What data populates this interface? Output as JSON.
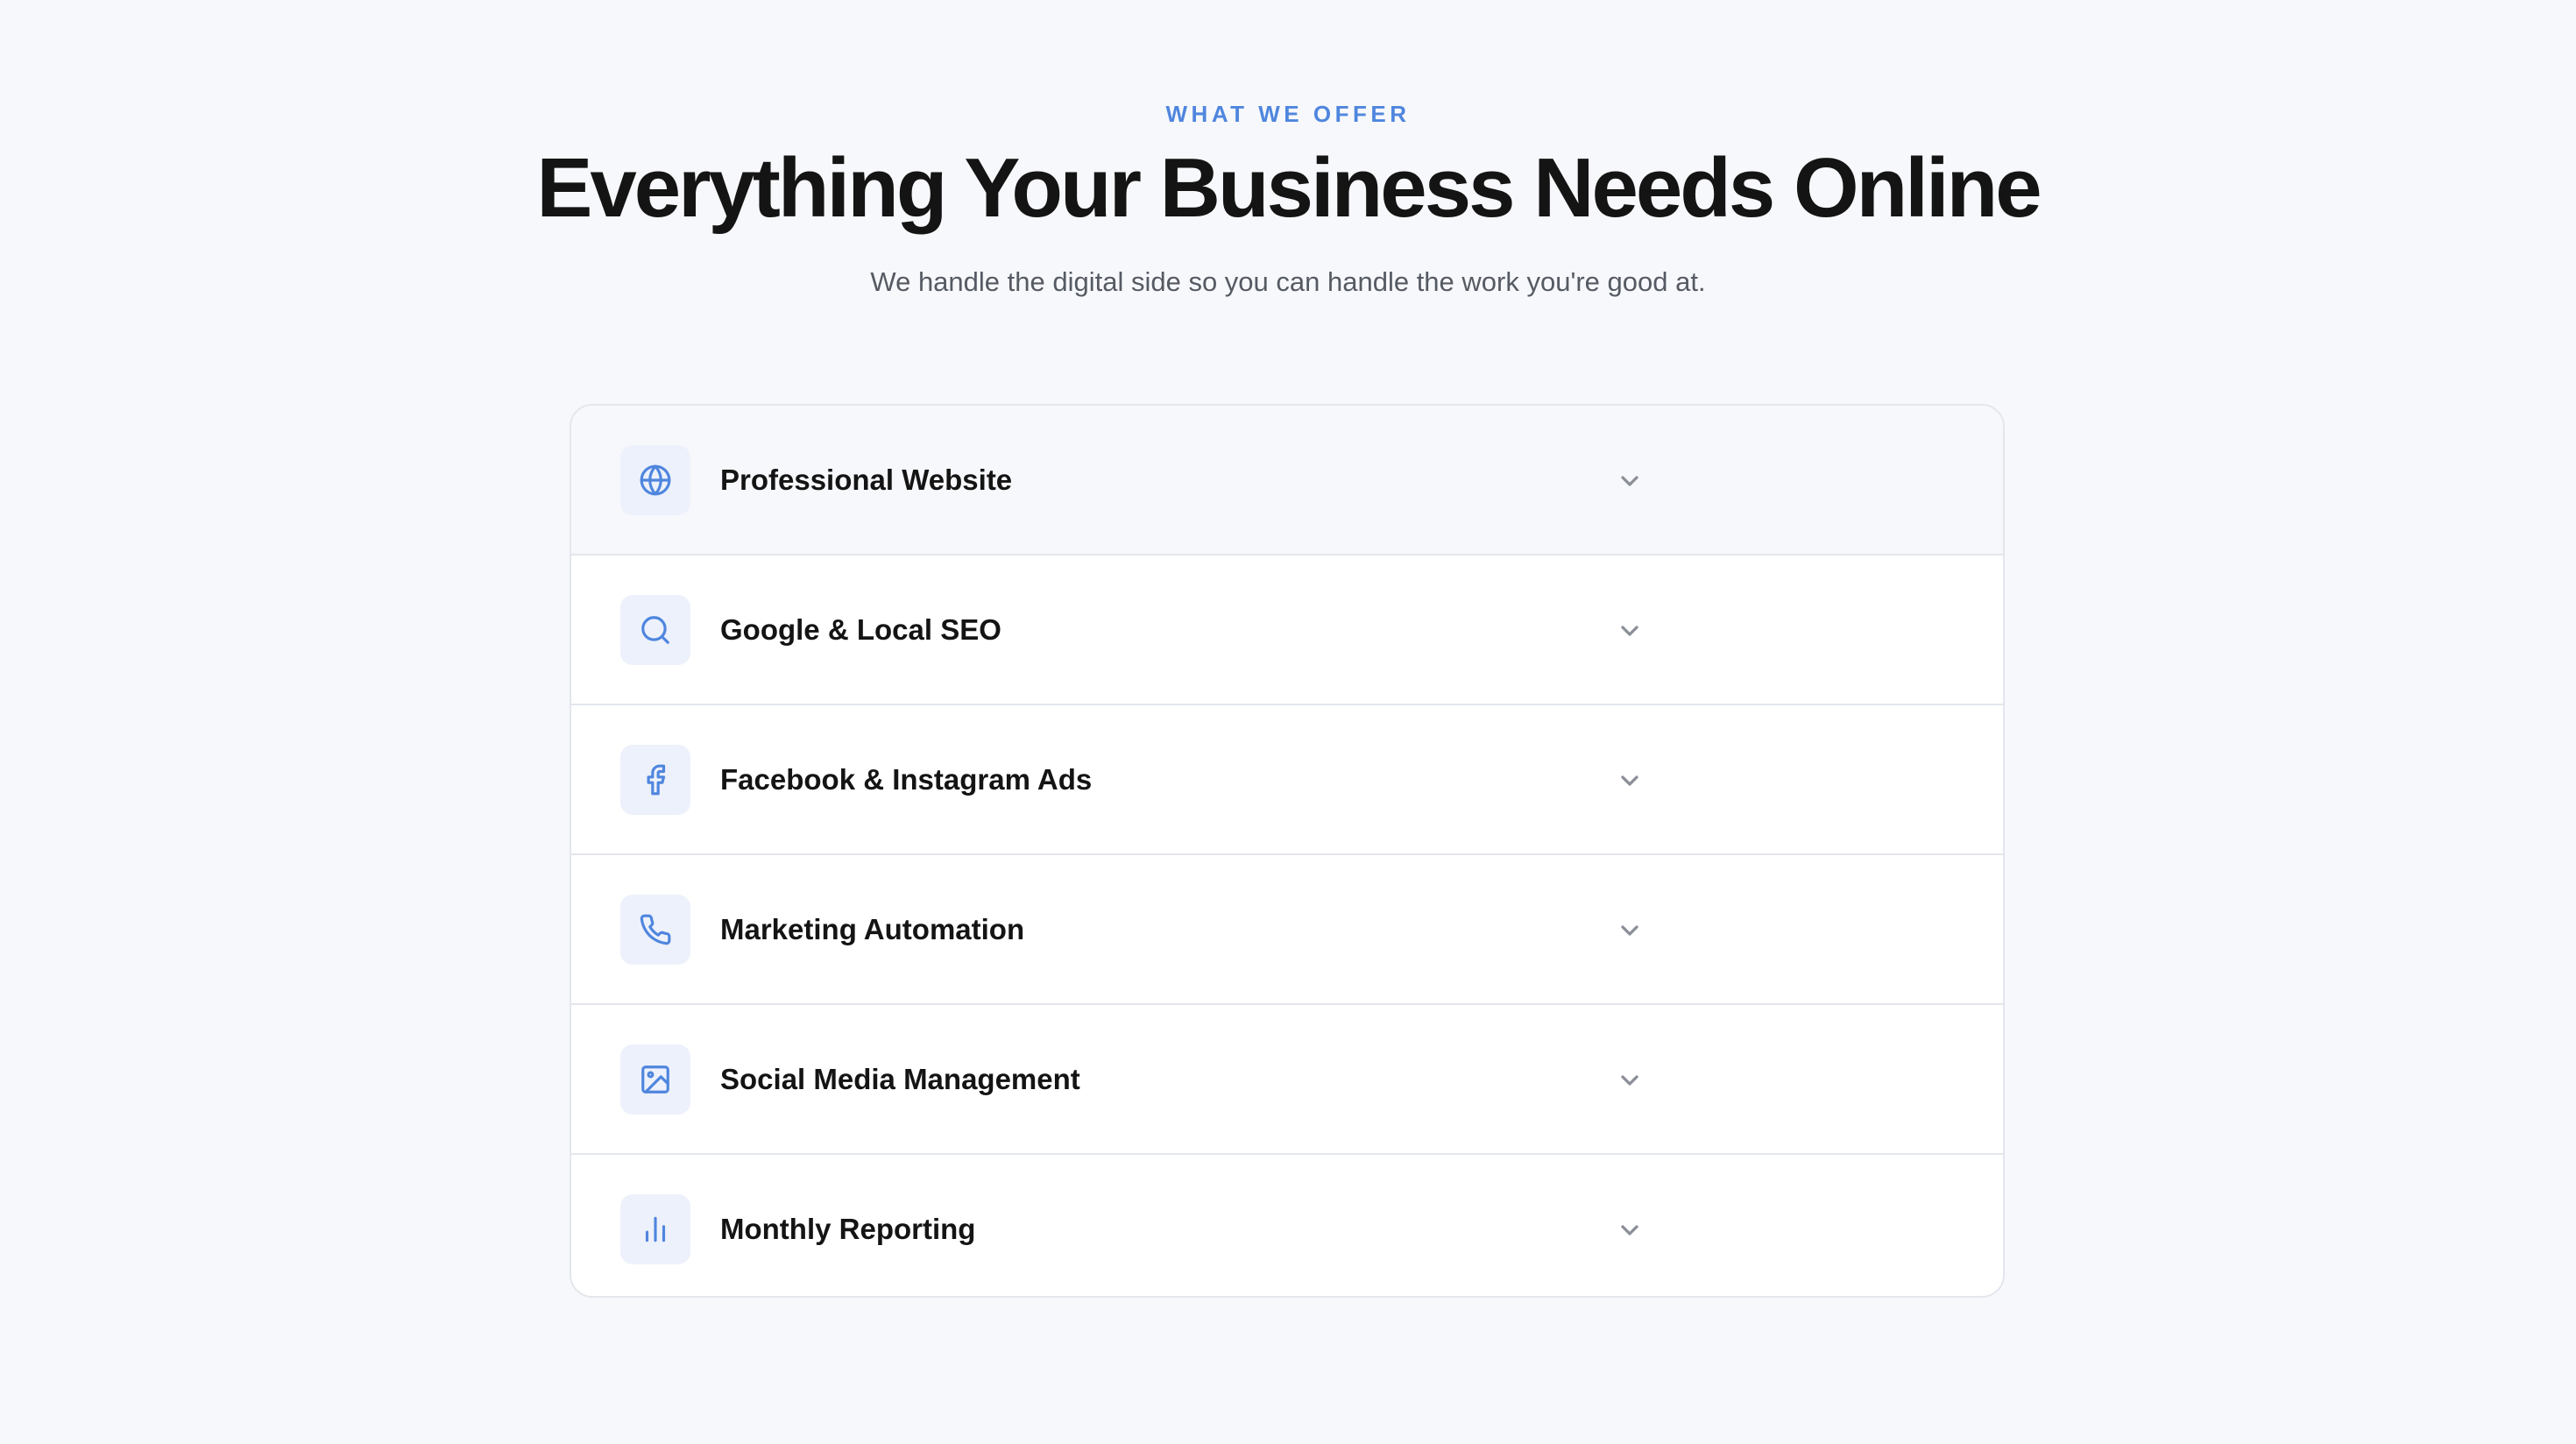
{
  "section": {
    "eyebrow": "WHAT WE OFFER",
    "title": "Everything Your Business Needs Online",
    "subtitle": "We handle the digital side so you can handle the work you're good at."
  },
  "services": [
    {
      "label": "Professional Website",
      "icon": "globe-icon",
      "expanded": false
    },
    {
      "label": "Google & Local SEO",
      "icon": "search-icon",
      "expanded": false
    },
    {
      "label": "Facebook & Instagram Ads",
      "icon": "facebook-icon",
      "expanded": false
    },
    {
      "label": "Marketing Automation",
      "icon": "phone-icon",
      "expanded": false
    },
    {
      "label": "Social Media Management",
      "icon": "image-icon",
      "expanded": false
    },
    {
      "label": "Monthly Reporting",
      "icon": "bar-chart-icon",
      "expanded": false
    }
  ],
  "colors": {
    "accent": "#4f86de",
    "heading": "#141414",
    "body_text": "#555a63",
    "background": "#f7f8fb",
    "card": "#ffffff",
    "border": "#e3e6ec",
    "icon_tile": "#edf1fb",
    "chevron": "#8a8f98"
  }
}
